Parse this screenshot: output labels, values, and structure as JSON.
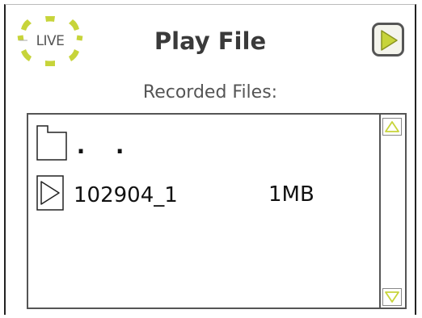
{
  "header": {
    "logo_text": "LIVE",
    "title": "Play File",
    "play_button": "play-icon"
  },
  "subtitle": "Recorded Files:",
  "file_list": {
    "parent_entry": {
      "icon": "folder-icon",
      "label": ". ."
    },
    "files": [
      {
        "icon": "play-icon",
        "name": "102904_1",
        "size": "1MB"
      }
    ]
  },
  "scrollbar": {
    "up_icon": "scroll-up-arrow-icon",
    "down_icon": "scroll-down-arrow-icon"
  },
  "colors": {
    "accent": "#c7d43a",
    "border": "#555555",
    "text": "#111111"
  }
}
